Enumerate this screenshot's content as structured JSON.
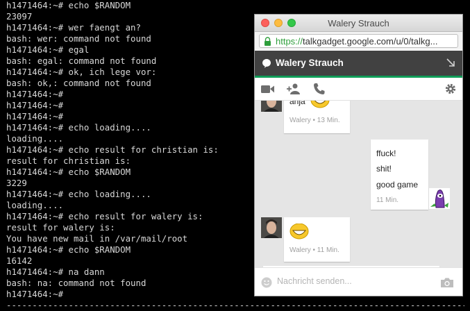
{
  "terminal": {
    "lines": [
      "h1471464:~# echo $RANDOM",
      "23097",
      "h1471464:~# wer faengt an?",
      "bash: wer: command not found",
      "h1471464:~# egal",
      "bash: egal: command not found",
      "h1471464:~# ok, ich lege vor:",
      "bash: ok,: command not found",
      "h1471464:~#",
      "h1471464:~#",
      "h1471464:~#",
      "h1471464:~# echo loading....",
      "loading....",
      "h1471464:~# echo result for christian is:",
      "result for christian is:",
      "h1471464:~# echo $RANDOM",
      "3229",
      "h1471464:~# echo loading....",
      "loading....",
      "h1471464:~# echo result for walery is:",
      "result for walery is:",
      "You have new mail in /var/mail/root",
      "h1471464:~# echo $RANDOM",
      "16142",
      "h1471464:~# na dann",
      "bash: na: command not found",
      "h1471464:~#"
    ],
    "bottom_dashes": "-------------------------------------------------------------------------------------------------"
  },
  "window": {
    "title": "Walery Strauch",
    "url_scheme": "https://",
    "url_rest": "talkgadget.google.com/u/0/talkg..."
  },
  "chat": {
    "contact_name": "Walery Strauch",
    "messages": [
      {
        "from": "Walery",
        "lines": [
          "anja"
        ],
        "emoji": "smiley-emoji",
        "meta": "Walery • 13 Min."
      },
      {
        "from": "me",
        "lines": [
          "ffuck!",
          "shit!",
          "good game"
        ],
        "meta": "11 Min."
      },
      {
        "from": "Walery",
        "lines": [],
        "emoji": "smiley-emoji",
        "meta": "Walery • 11 Min."
      }
    ],
    "input_placeholder": "Nachricht senden..."
  },
  "colors": {
    "terminal_bg": "#000000",
    "terminal_fg": "#d8d8d8",
    "header_bg": "#414141",
    "accent_green": "#0f9d58",
    "url_green": "#2e9e3b"
  },
  "icons": [
    "lock-icon",
    "speech-bubble-icon",
    "minimize-arrow-icon",
    "video-call-icon",
    "add-person-icon",
    "phone-icon",
    "gear-icon",
    "smiley-icon",
    "camera-icon"
  ]
}
